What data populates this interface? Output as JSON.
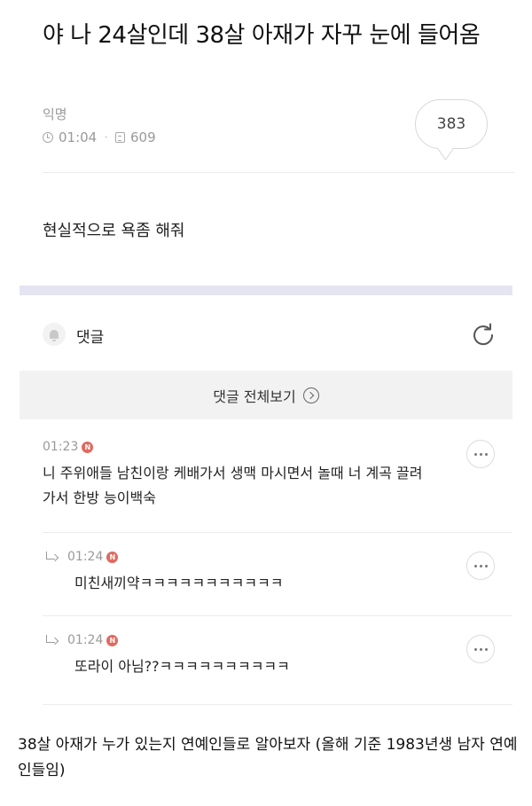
{
  "post": {
    "title": "야 나 24살인데 38살 아재가 자꾸 눈에 들어옴",
    "author": "익명",
    "time": "01:04",
    "views": "609",
    "comment_count": "383",
    "body": "현실적으로 욕좀 해줘"
  },
  "comments_section": {
    "label": "댓글",
    "view_all_label": "댓글 전체보기"
  },
  "comments": [
    {
      "time": "01:23",
      "badge": "N",
      "text": "니 주위애들 남친이랑 케배가서 생맥 마시면서 놀때 너 계곡 끌려가서 한방 능이백숙"
    },
    {
      "time": "01:24",
      "badge": "N",
      "text": "미친새끼약ㅋㅋㅋㅋㅋㅋㅋㅋㅋㅋㅋ"
    },
    {
      "time": "01:24",
      "badge": "N",
      "text": "또라이 아님??ㅋㅋㅋㅋㅋㅋㅋㅋㅋㅋ"
    }
  ],
  "caption": "38살 아재가 누가 있는지 연예인들로 알아보자 (올해 기준 1983년생 남자 연예인들임)",
  "colors": {
    "badge": "#e06a5e",
    "band": "#e4e4f2",
    "view_all_bg": "#f2f2f2",
    "meta_gray": "#9a9a9a"
  },
  "icons": [
    "clock-icon",
    "document-icon",
    "bell-icon",
    "refresh-icon",
    "circle-arrow-right-icon",
    "new-badge-icon",
    "more-options-icon",
    "reply-arrow-icon"
  ]
}
